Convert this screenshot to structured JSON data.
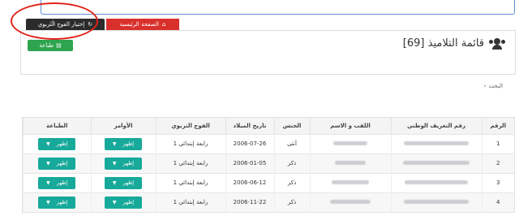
{
  "tabs": {
    "home_label": "الصفحة الرئيسية",
    "choose_label": "إختيار الفوج التربوي"
  },
  "panel": {
    "title": "قائمة التلاميذ [69]",
    "print_label": "طباعة"
  },
  "search": {
    "label": "البحث"
  },
  "table": {
    "headers": [
      "الرقم",
      "رقم التعريف الوطني",
      "اللقب و الاسم",
      "الجنس",
      "تاريخ الميلاد",
      "الفوج التربوي",
      "الأوامر",
      "الطباعة"
    ],
    "rows": [
      {
        "num": "1",
        "gender": "أنثى",
        "dob": "2006-07-26",
        "group": "رابعة إبتدائي 1",
        "cmd": "إظهر",
        "print": "إظهر"
      },
      {
        "num": "2",
        "gender": "ذكر",
        "dob": "2006-01-05",
        "group": "رابعة إبتدائي 1",
        "cmd": "إظهر",
        "print": "إظهر"
      },
      {
        "num": "3",
        "gender": "ذكر",
        "dob": "2006-06-12",
        "group": "رابعة إبتدائي 1",
        "cmd": "إظهر",
        "print": "إظهر"
      },
      {
        "num": "4",
        "gender": "ذكر",
        "dob": "2006-11-22",
        "group": "رابعة إبتدائي 1",
        "cmd": "إظهر",
        "print": "إظهر"
      }
    ]
  },
  "colors": {
    "home_tab": "#d9302c",
    "print_button": "#2ea44f",
    "action_button": "#17a99a",
    "annotation": "#e2231a"
  }
}
